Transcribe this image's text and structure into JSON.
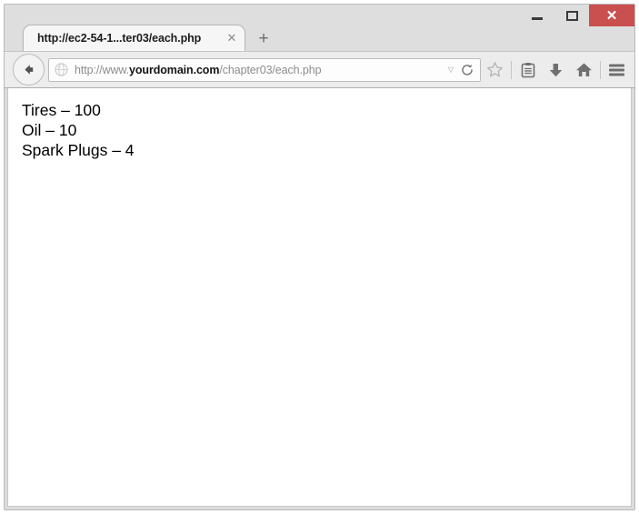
{
  "window": {
    "controls": {
      "minimize_label": "–",
      "maximize_label": "",
      "close_label": "✕"
    }
  },
  "tabs": [
    {
      "title": "http://ec2-54-1...ter03/each.php",
      "close_label": "✕"
    }
  ],
  "newtab": {
    "label": "+"
  },
  "navbar": {
    "back_label": "",
    "url": {
      "scheme": "http://www.",
      "host": "yourdomain.com",
      "path": "/chapter03/each.php",
      "full": "http://www.yourdomain.com/chapter03/each.php",
      "dropdown_label": "▽"
    },
    "icons": [
      {
        "name": "bookmark-star-icon"
      },
      {
        "name": "reader-list-icon"
      },
      {
        "name": "downloads-arrow-icon"
      },
      {
        "name": "home-icon"
      },
      {
        "name": "hamburger-menu-icon"
      }
    ]
  },
  "page": {
    "lines": [
      "Tires – 100",
      "Oil – 10",
      "Spark Plugs – 4"
    ]
  },
  "colors": {
    "close_red": "#c9504f",
    "frame_gray": "#dedede",
    "navbar_gray": "#ececec",
    "tab_active": "#f6f6f6",
    "page_bg": "#ffffff",
    "text": "#000000"
  }
}
